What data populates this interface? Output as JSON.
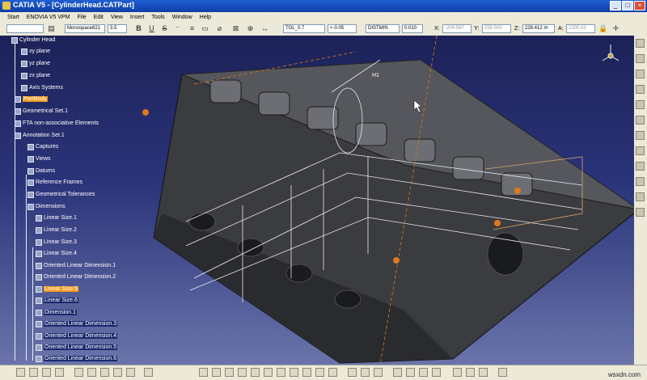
{
  "window": {
    "title": "CATIA V5 - [CylinderHead.CATPart]"
  },
  "menu": [
    "Start",
    "ENOVIA V5 VPM",
    "File",
    "Edit",
    "View",
    "Insert",
    "Tools",
    "Window",
    "Help"
  ],
  "toolbar": {
    "font_name": "Monospace821",
    "font_size": "3.5",
    "tolerance": "TOL_0.7",
    "tolerance_value": "+-0.05",
    "dim_style": "DISTMIN",
    "dim_value": "0.010",
    "coord_x_label": "X:",
    "coord_x": "-204.587",
    "coord_y_label": "Y:",
    "coord_y": "258.500",
    "coord_z_label": "Z:",
    "coord_z": "228.412 m",
    "coord_a_label": "A:",
    "coord_a": "2300.63"
  },
  "tree": {
    "root": "Cylinder Head",
    "items": [
      {
        "label": "xy plane"
      },
      {
        "label": "yz plane"
      },
      {
        "label": "zx plane"
      },
      {
        "label": "Axis Systems"
      },
      {
        "label": "PartBody",
        "state": "highlight"
      },
      {
        "label": "Geometrical Set.1"
      },
      {
        "label": "FTA non-associative Elements"
      },
      {
        "label": "Annotation Set.1"
      },
      {
        "label": "Captures"
      },
      {
        "label": "Views"
      },
      {
        "label": "Datums"
      },
      {
        "label": "Reference Frames"
      },
      {
        "label": "Geometrical Tolerances"
      },
      {
        "label": "Dimensions"
      },
      {
        "label": "Linear Size.1"
      },
      {
        "label": "Linear Size.2"
      },
      {
        "label": "Linear Size.3"
      },
      {
        "label": "Linear Size.4"
      },
      {
        "label": "Oriented Linear Dimension.1"
      },
      {
        "label": "Oriented Linear Dimension.2"
      },
      {
        "label": "Linear Size.5",
        "state": "highlight"
      },
      {
        "label": "Linear Size.6",
        "state": "selected"
      },
      {
        "label": "Dimension.1",
        "state": "selected"
      },
      {
        "label": "Oriented Linear Dimension.3",
        "state": "selected"
      },
      {
        "label": "Oriented Linear Dimension.4",
        "state": "selected"
      },
      {
        "label": "Oriented Linear Dimension.5",
        "state": "selected"
      },
      {
        "label": "Oriented Linear Dimension.6",
        "state": "selected"
      }
    ]
  },
  "viewport": {
    "annotation": "H1"
  },
  "watermark": "wsxdn.com",
  "colors": {
    "highlight": "#f29a1e",
    "viewport_top": "#1c2258",
    "viewport_bottom": "#6a74aa"
  }
}
